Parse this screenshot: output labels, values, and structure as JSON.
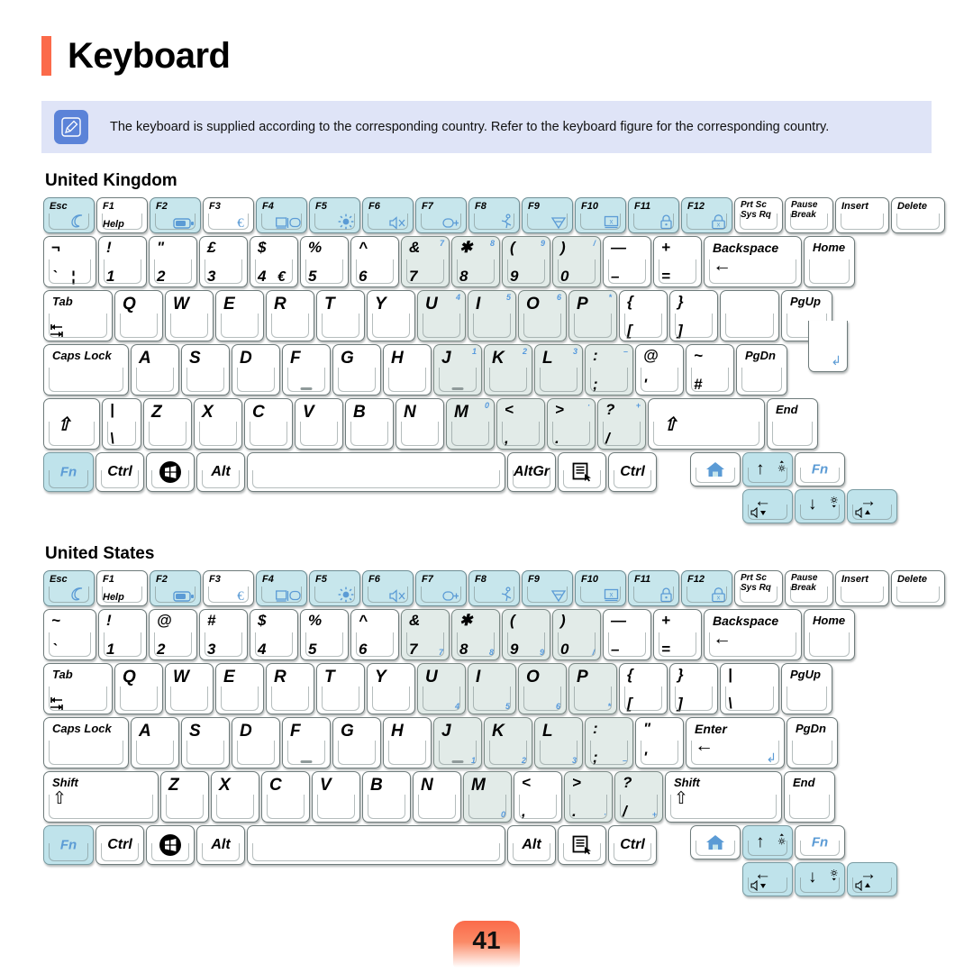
{
  "page": {
    "title": "Keyboard",
    "number": "41",
    "accent_color": "#fb6a4a",
    "note_bg": "#dfe4f7",
    "note_icon_bg": "#5b83d8",
    "fn_key_color": "#5b9bd5",
    "highlight_color": "#c7e6ec"
  },
  "note": {
    "icon": "pencil-icon",
    "text": "The keyboard is supplied according to the corresponding country. Refer to the keyboard figure for the corresponding country."
  },
  "sections": [
    {
      "id": "uk",
      "title": "United Kingdom"
    },
    {
      "id": "us",
      "title": "United States"
    }
  ],
  "uk": {
    "fn_row": [
      {
        "top": "Esc",
        "icon": "moon-icon",
        "hl": true
      },
      {
        "top": "F1",
        "bottom": "Help",
        "hl": false
      },
      {
        "top": "F2",
        "icon": "battery-icon",
        "hl": true
      },
      {
        "top": "F3",
        "icon": "euro-icon",
        "hl": false
      },
      {
        "top": "F4",
        "icon": "display-switch-icon",
        "hl": true
      },
      {
        "top": "F5",
        "icon": "brightness-icon",
        "hl": true
      },
      {
        "top": "F6",
        "icon": "mute-icon",
        "hl": true
      },
      {
        "top": "F7",
        "icon": "wireless-lock-icon",
        "hl": true
      },
      {
        "top": "F8",
        "icon": "runner-icon",
        "hl": true
      },
      {
        "top": "F9",
        "icon": "wifi-icon",
        "hl": true
      },
      {
        "top": "F10",
        "icon": "screen-lock-icon",
        "hl": true
      },
      {
        "top": "F11",
        "icon": "padlock-icon",
        "hl": true
      },
      {
        "top": "F12",
        "icon": "secure-lock-icon",
        "hl": true
      },
      {
        "two": "Prt Sc|Sys Rq",
        "hl": false
      },
      {
        "two": "Pause|Break",
        "hl": false
      },
      {
        "top": "Insert",
        "hl": false
      },
      {
        "top": "Delete",
        "hl": false
      }
    ],
    "num_row": [
      {
        "up": "¬",
        "low": "`",
        "low2": "¦",
        "tint": false
      },
      {
        "up": "!",
        "low": "1",
        "tint": false
      },
      {
        "up": "\"",
        "low": "2",
        "tint": false
      },
      {
        "up": "£",
        "low": "3",
        "tint": false
      },
      {
        "up": "$",
        "low": "4",
        "low2": "€",
        "tint": false
      },
      {
        "up": "%",
        "low": "5",
        "tint": false
      },
      {
        "up": "^",
        "low": "6",
        "tint": false
      },
      {
        "up": "&",
        "low": "7",
        "fnlab": "7",
        "tint": true
      },
      {
        "up": "✱",
        "low": "8",
        "fnlab": "8",
        "tint": true
      },
      {
        "up": "(",
        "low": "9",
        "fnlab": "9",
        "tint": true
      },
      {
        "up": ")",
        "low": "0",
        "fnlab": "/",
        "tint": true
      },
      {
        "up": "—",
        "low": "–",
        "tint": false
      },
      {
        "up": "+",
        "low": "=",
        "tint": false
      },
      {
        "word": "Backspace",
        "arrow": "←",
        "tint": false
      },
      {
        "word_only": "Home",
        "tint": false
      }
    ],
    "q_row": [
      {
        "two": "Tab",
        "icon": "tab-icon"
      },
      {
        "c": "Q"
      },
      {
        "c": "W"
      },
      {
        "c": "E"
      },
      {
        "c": "R"
      },
      {
        "c": "T"
      },
      {
        "c": "Y"
      },
      {
        "c": "U",
        "fnlab": "4",
        "tint": true
      },
      {
        "c": "I",
        "fnlab": "5",
        "tint": true
      },
      {
        "c": "O",
        "fnlab": "6",
        "tint": true
      },
      {
        "c": "P",
        "fnlab": "*",
        "tint": true
      },
      {
        "up": "{",
        "low": "["
      },
      {
        "up": "}",
        "low": "]"
      },
      {
        "enter": "←"
      },
      {
        "word_only": "PgUp"
      }
    ],
    "a_row": [
      {
        "word_tl": "Caps Lock"
      },
      {
        "c": "A"
      },
      {
        "c": "S"
      },
      {
        "c": "D"
      },
      {
        "c": "F",
        "bump": true
      },
      {
        "c": "G"
      },
      {
        "c": "H"
      },
      {
        "c": "J",
        "fnlab": "1",
        "tint": true,
        "bump": true
      },
      {
        "c": "K",
        "fnlab": "2",
        "tint": true
      },
      {
        "c": "L",
        "fnlab": "3",
        "tint": true
      },
      {
        "up": ":",
        "low": ";",
        "fnlab": "–",
        "tint": true
      },
      {
        "up": "@",
        "low": "'"
      },
      {
        "up": "~",
        "low": "#"
      },
      {
        "word_only": "PgDn"
      }
    ],
    "z_row": [
      {
        "shift_small": "⇧"
      },
      {
        "up": "|",
        "low": "\\"
      },
      {
        "c": "Z"
      },
      {
        "c": "X"
      },
      {
        "c": "C"
      },
      {
        "c": "V"
      },
      {
        "c": "B"
      },
      {
        "c": "N"
      },
      {
        "c": "M",
        "fnlab": "0",
        "tint": true
      },
      {
        "up": "<",
        "low": ",",
        "tint": true
      },
      {
        "up": ">",
        "low": ".",
        "fnlab": "·",
        "tint": true
      },
      {
        "up": "?",
        "low": "/",
        "fnlab": "+",
        "tint": true
      },
      {
        "shift_wide": "⇧"
      },
      {
        "word_only": "End"
      }
    ],
    "bottom_row": [
      {
        "fn": "Fn",
        "cyan": true
      },
      {
        "c2": "Ctrl"
      },
      {
        "icon": "windows-icon"
      },
      {
        "c2": "Alt"
      },
      {
        "space": true
      },
      {
        "c2": "AltGr"
      },
      {
        "icon": "menu-icon"
      },
      {
        "c2": "Ctrl"
      }
    ],
    "arrows": {
      "home": {
        "icon": "home-icon"
      },
      "up": {
        "arrow": "↑",
        "fn": "brightness-up-icon",
        "hl": true
      },
      "fn_right": {
        "label": "Fn"
      },
      "left": {
        "arrow": "←",
        "fn": "volume-down-icon",
        "hl": true
      },
      "down": {
        "arrow": "↓",
        "fn": "brightness-down-icon",
        "hl": true
      },
      "right": {
        "arrow": "→",
        "fn": "volume-up-icon",
        "hl": true
      }
    }
  },
  "us": {
    "fn_row": [
      {
        "top": "Esc",
        "icon": "moon-icon",
        "hl": true
      },
      {
        "top": "F1",
        "bottom": "Help",
        "hl": false
      },
      {
        "top": "F2",
        "icon": "battery-icon",
        "hl": true
      },
      {
        "top": "F3",
        "icon": "euro-icon",
        "hl": false
      },
      {
        "top": "F4",
        "icon": "display-switch-icon",
        "hl": true
      },
      {
        "top": "F5",
        "icon": "brightness-icon",
        "hl": true
      },
      {
        "top": "F6",
        "icon": "mute-icon",
        "hl": true
      },
      {
        "top": "F7",
        "icon": "wireless-lock-icon",
        "hl": true
      },
      {
        "top": "F8",
        "icon": "runner-icon",
        "hl": true
      },
      {
        "top": "F9",
        "icon": "wifi-icon",
        "hl": true
      },
      {
        "top": "F10",
        "icon": "screen-lock-icon",
        "hl": true
      },
      {
        "top": "F11",
        "icon": "padlock-icon",
        "hl": true
      },
      {
        "top": "F12",
        "icon": "secure-lock-icon",
        "hl": true
      },
      {
        "two": "Prt Sc|Sys Rq",
        "hl": false
      },
      {
        "two": "Pause|Break",
        "hl": false
      },
      {
        "top": "Insert",
        "hl": false
      },
      {
        "top": "Delete",
        "hl": false
      }
    ],
    "num_row": [
      {
        "up": "~",
        "low": "`",
        "tint": false
      },
      {
        "up": "!",
        "low": "1",
        "tint": false
      },
      {
        "up": "@",
        "low": "2",
        "tint": false
      },
      {
        "up": "#",
        "low": "3",
        "tint": false
      },
      {
        "up": "$",
        "low": "4",
        "tint": false
      },
      {
        "up": "%",
        "low": "5",
        "tint": false
      },
      {
        "up": "^",
        "low": "6",
        "tint": false
      },
      {
        "up": "&",
        "low": "7",
        "fnbr": "7",
        "tint": true
      },
      {
        "up": "✱",
        "low": "8",
        "fnbr": "8",
        "tint": true
      },
      {
        "up": "(",
        "low": "9",
        "fnbr": "9",
        "tint": true
      },
      {
        "up": ")",
        "low": "0",
        "fnbr": "/",
        "tint": true
      },
      {
        "up": "—",
        "low": "–",
        "tint": false
      },
      {
        "up": "+",
        "low": "=",
        "tint": false
      },
      {
        "word": "Backspace",
        "arrow": "←",
        "tint": false
      },
      {
        "word_only": "Home",
        "tint": false
      }
    ],
    "q_row": [
      {
        "two": "Tab",
        "icon": "tab-icon"
      },
      {
        "c": "Q"
      },
      {
        "c": "W"
      },
      {
        "c": "E"
      },
      {
        "c": "R"
      },
      {
        "c": "T"
      },
      {
        "c": "Y"
      },
      {
        "c": "U",
        "fnbr": "4",
        "tint": true
      },
      {
        "c": "I",
        "fnbr": "5",
        "tint": true
      },
      {
        "c": "O",
        "fnbr": "6",
        "tint": true
      },
      {
        "c": "P",
        "fnbr": "*",
        "tint": true
      },
      {
        "up": "{",
        "low": "["
      },
      {
        "up": "}",
        "low": "]"
      },
      {
        "up": "|",
        "low": "\\"
      },
      {
        "word_only": "PgUp"
      }
    ],
    "a_row": [
      {
        "word_tl": "Caps Lock"
      },
      {
        "c": "A"
      },
      {
        "c": "S"
      },
      {
        "c": "D"
      },
      {
        "c": "F",
        "bump": true
      },
      {
        "c": "G"
      },
      {
        "c": "H"
      },
      {
        "c": "J",
        "fnbr": "1",
        "tint": true,
        "bump": true
      },
      {
        "c": "K",
        "fnbr": "2",
        "tint": true
      },
      {
        "c": "L",
        "fnbr": "3",
        "tint": true
      },
      {
        "up": ":",
        "low": ";",
        "fnbr": "–",
        "tint": true
      },
      {
        "up": "\"",
        "low": "'"
      },
      {
        "enter_wide": "Enter",
        "arrow": "←"
      },
      {
        "word_only": "PgDn"
      }
    ],
    "z_row": [
      {
        "shift_us": "Shift",
        "arrow": "⇧"
      },
      {
        "c": "Z"
      },
      {
        "c": "X"
      },
      {
        "c": "C"
      },
      {
        "c": "V"
      },
      {
        "c": "B"
      },
      {
        "c": "N"
      },
      {
        "c": "M",
        "fnbr": "0",
        "tint": true
      },
      {
        "up": "<",
        "low": ","
      },
      {
        "up": ">",
        "low": ".",
        "fnbr": "·",
        "tint": true
      },
      {
        "up": "?",
        "low": "/",
        "fnbr": "+",
        "tint": true
      },
      {
        "shift_us": "Shift",
        "arrow": "⇧"
      },
      {
        "word_only": "End"
      }
    ],
    "bottom_row": [
      {
        "fn": "Fn",
        "cyan": true
      },
      {
        "c2": "Ctrl"
      },
      {
        "icon": "windows-icon"
      },
      {
        "c2": "Alt"
      },
      {
        "space": true
      },
      {
        "c2": "Alt"
      },
      {
        "icon": "menu-icon"
      },
      {
        "c2": "Ctrl"
      }
    ],
    "arrows": {
      "home": {
        "icon": "home-icon"
      },
      "up": {
        "arrow": "↑",
        "fn": "brightness-up-icon",
        "hl": true
      },
      "fn_right": {
        "label": "Fn"
      },
      "left": {
        "arrow": "←",
        "fn": "volume-down-icon",
        "hl": true
      },
      "down": {
        "arrow": "↓",
        "fn": "brightness-down-icon",
        "hl": true
      },
      "right": {
        "arrow": "→",
        "fn": "volume-up-icon",
        "hl": true
      }
    }
  }
}
